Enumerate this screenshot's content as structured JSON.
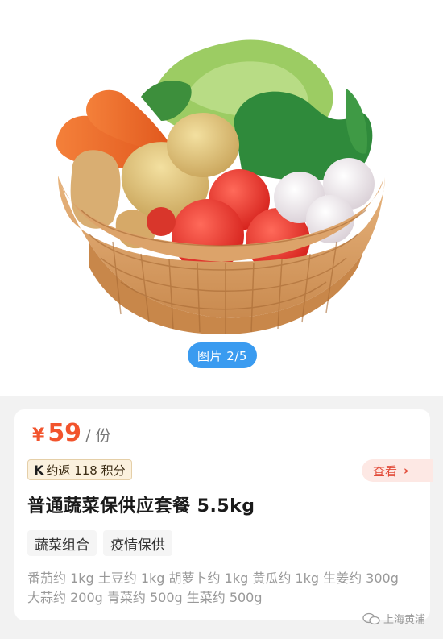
{
  "gallery": {
    "indicator": "图片 2/5"
  },
  "product": {
    "currency": "¥",
    "price": "59",
    "unit": "/ 份",
    "points_badge": "约返 118 积分",
    "points_logo": "K",
    "view_label": "查看",
    "title": "普通蔬菜保供应套餐 5.5kg",
    "tags": [
      "蔬菜组合",
      "疫情保供"
    ],
    "description": "番茄约 1kg 土豆约 1kg 胡萝卜约 1kg 黄瓜约 1kg 生姜约 300g 大蒜约 200g 青菜约 500g 生菜约 500g"
  },
  "watermark": {
    "text": "上海黄浦"
  },
  "colors": {
    "price": "#f2542d",
    "indicator_bg": "#3a9bf0",
    "view_btn_text": "#e24a38",
    "badge_bg": "#fbf1de"
  }
}
